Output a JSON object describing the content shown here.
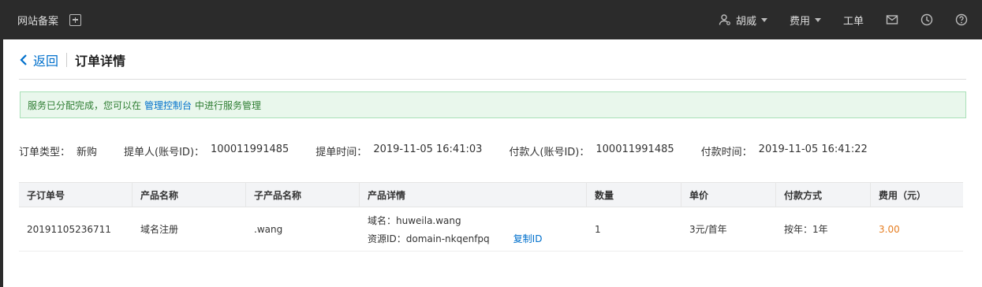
{
  "topbar": {
    "brand": "网站备案",
    "user": "胡威",
    "fee_menu": "费用",
    "ticket": "工单"
  },
  "header": {
    "back_label": "返回",
    "title": "订单详情"
  },
  "notice": {
    "prefix": "服务已分配完成，您可以在",
    "link": "管理控制台",
    "suffix": "中进行服务管理"
  },
  "meta": [
    {
      "label": "订单类型：",
      "value": "新购"
    },
    {
      "label": "提单人(账号ID)：",
      "value": "100011991485"
    },
    {
      "label": "提单时间：",
      "value": "2019-11-05 16:41:03"
    },
    {
      "label": "付款人(账号ID)：",
      "value": "100011991485"
    },
    {
      "label": "付款时间：",
      "value": "2019-11-05 16:41:22"
    }
  ],
  "table": {
    "headers": [
      "子订单号",
      "产品名称",
      "子产品名称",
      "产品详情",
      "数量",
      "单价",
      "付款方式",
      "费用（元）"
    ],
    "rows": [
      {
        "sub_order": "20191105236711",
        "product": "域名注册",
        "sub_product": ".wang",
        "detail_domain": "域名：huweila.wang",
        "detail_resource": "资源ID：domain-nkqenfpq",
        "copy_label": "复制ID",
        "quantity": "1",
        "unit_price": "3元/首年",
        "payment": "按年：1年",
        "fee": "3.00"
      }
    ]
  },
  "colors": {
    "accent": "#0070cc",
    "fee": "#e67e22",
    "notice_bg": "#e9f7ec"
  }
}
